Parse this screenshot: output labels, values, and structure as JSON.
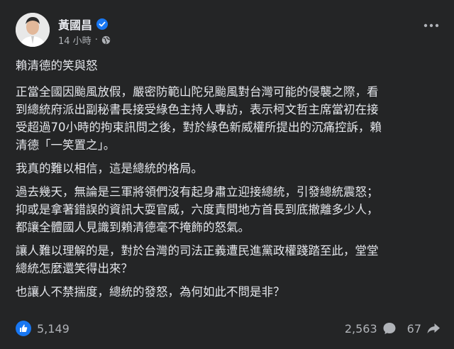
{
  "post": {
    "author": "黃國昌",
    "time": "14 小時",
    "separator": "·",
    "title": "賴清德的笑與怒",
    "paragraphs": [
      "正當全國因颱風放假，嚴密防範山陀兒颱風對台灣可能的侵襲之際，看\n到總統府派出副秘書長接受綠色主持人專訪，表示柯文哲主席當初在接\n受超過70小時的拘束訊問之後，對於綠色新威權所提出的沉痛控訴，賴\n清德「一笑置之」。",
      "我真的難以相信，這是總統的格局。",
      "過去幾天，無論是三軍將領們沒有起身肅立迎接總統，引發總統震怒；\n抑或是拿著錯誤的資訊大耍官威，六度責問地方首長到底撤離多少人，\n都讓全體國人見識到賴清德毫不掩飾的怒氣。",
      "讓人難以理解的是，對於台灣的司法正義遭民進黨政權踐踏至此，堂堂\n總統怎麼還笑得出來？",
      "也讓人不禁揣度，總統的發怒，為何如此不問是非？"
    ]
  },
  "footer": {
    "reactions_count": "5,149",
    "comments_count": "2,563",
    "shares_count": "67"
  },
  "colors": {
    "background": "#242526",
    "text": "#e4e6eb",
    "secondary": "#b0b3b8",
    "accent": "#1877f2"
  },
  "icons": {
    "verified": "verified-badge-icon",
    "privacy": "globe-icon",
    "more": "more-options-icon",
    "like": "like-reaction-icon",
    "comment": "comment-icon",
    "share": "share-icon"
  }
}
